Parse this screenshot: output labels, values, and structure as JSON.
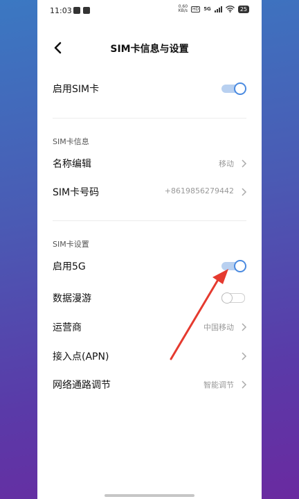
{
  "status": {
    "time": "11:03",
    "net_speed": "0.60\nKB/s",
    "hd": "HD",
    "signal": "5G",
    "battery": "25"
  },
  "header": {
    "title": "SIM卡信息与设置"
  },
  "enable_sim": {
    "label": "启用SIM卡",
    "enabled": true
  },
  "sim_info": {
    "section": "SIM卡信息",
    "name_label": "名称编辑",
    "name_value": "移动",
    "number_label": "SIM卡号码",
    "number_value": "+8619856279442"
  },
  "sim_settings": {
    "section": "SIM卡设置",
    "enable_5g_label": "启用5G",
    "enable_5g": true,
    "roaming_label": "数据漫游",
    "roaming": false,
    "carrier_label": "运营商",
    "carrier_value": "中国移动",
    "apn_label": "接入点(APN)",
    "route_label": "网络通路调节",
    "route_value": "智能调节"
  },
  "colors": {
    "accent": "#4a8ae0",
    "annotation_arrow": "#e53a2f"
  }
}
